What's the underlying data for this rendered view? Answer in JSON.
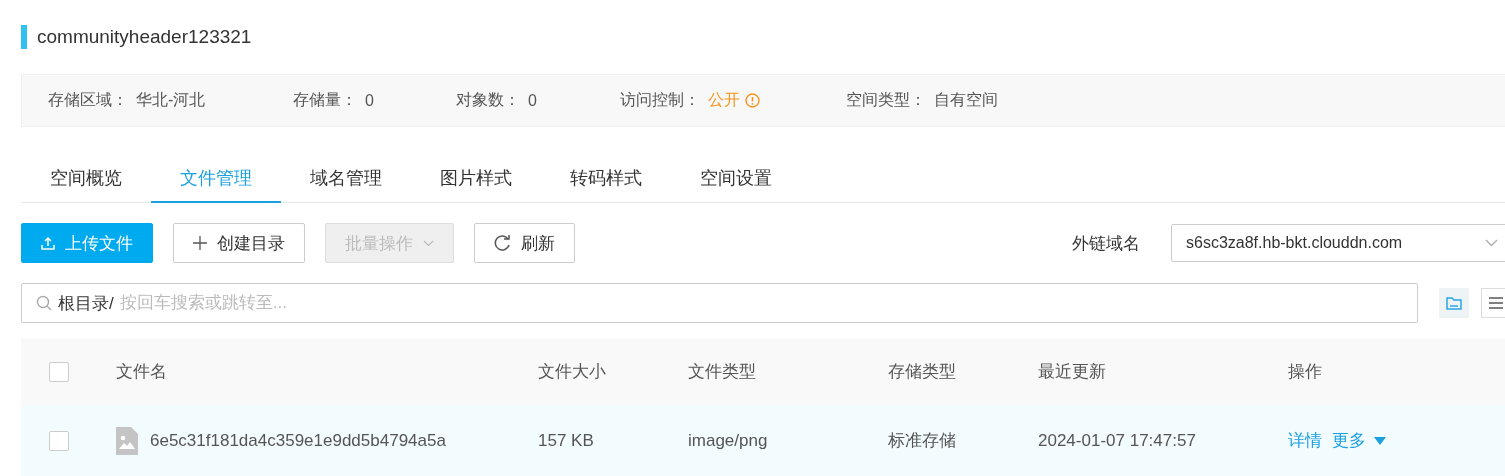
{
  "title": "communityheader123321",
  "info": [
    {
      "label": "存储区域：",
      "value": "华北-河北",
      "kind": "plain"
    },
    {
      "label": "存储量：",
      "value": "0",
      "kind": "plain"
    },
    {
      "label": "对象数：",
      "value": "0",
      "kind": "plain"
    },
    {
      "label": "访问控制：",
      "value": "公开",
      "kind": "warning"
    },
    {
      "label": "空间类型：",
      "value": "自有空间",
      "kind": "plain"
    }
  ],
  "tabs": [
    {
      "label": "空间概览",
      "selected": false
    },
    {
      "label": "文件管理",
      "selected": true
    },
    {
      "label": "域名管理",
      "selected": false
    },
    {
      "label": "图片样式",
      "selected": false
    },
    {
      "label": "转码样式",
      "selected": false
    },
    {
      "label": "空间设置",
      "selected": false
    }
  ],
  "toolbar": [
    {
      "label": "上传文件",
      "kind": "upload",
      "disabled": false
    },
    {
      "label": "创建目录",
      "kind": "create",
      "disabled": false
    },
    {
      "label": "批量操作",
      "kind": "batch",
      "disabled": true
    },
    {
      "label": "刷新",
      "kind": "refresh",
      "disabled": false
    }
  ],
  "domain": {
    "label": "外链域名",
    "value": "s6sc3za8f.hb-bkt.clouddn.com"
  },
  "search": {
    "prefix": "根目录/",
    "placeholder": "按回车搜索或跳转至..."
  },
  "view_toggle": [
    {
      "kind": "folder",
      "selected": true
    },
    {
      "kind": "list",
      "selected": false
    }
  ],
  "table": {
    "columns": [
      "文件名",
      "文件大小",
      "文件类型",
      "存储类型",
      "最近更新",
      "操作"
    ],
    "header_checked": false,
    "rows": [
      {
        "checked": false,
        "name": "6e5c31f181da4c359e1e9dd5b4794a5a",
        "size": "157 KB",
        "type": "image/png",
        "storage": "标准存储",
        "updated": "2024-01-07 17:47:57",
        "actions": [
          "详情",
          "更多"
        ]
      }
    ]
  }
}
